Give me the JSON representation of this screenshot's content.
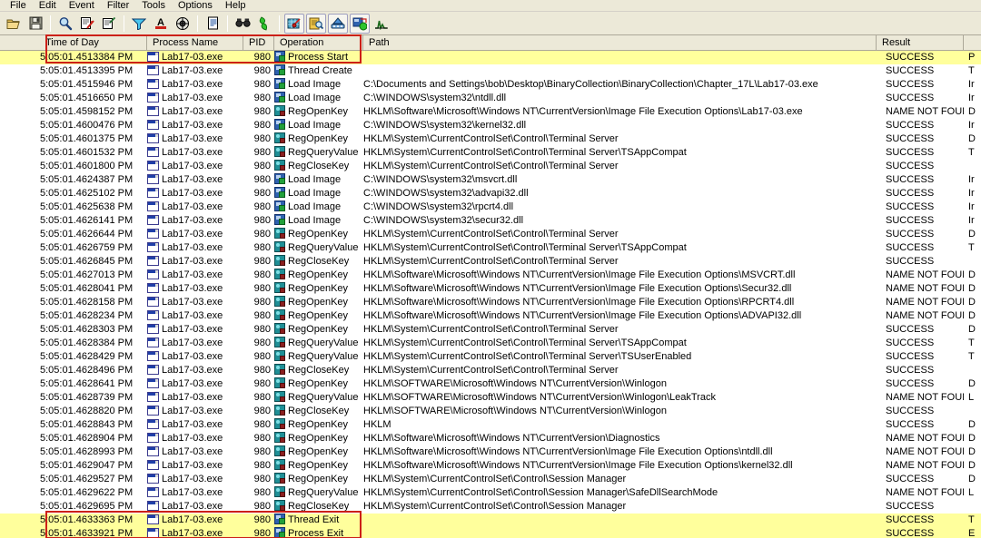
{
  "window": {
    "app_name": "Process Monitor"
  },
  "menubar": {
    "items": [
      "File",
      "Edit",
      "Event",
      "Filter",
      "Tools",
      "Options",
      "Help"
    ]
  },
  "toolbar": {
    "buttons": [
      {
        "name": "open-icon",
        "tip": "Open"
      },
      {
        "name": "save-icon",
        "tip": "Save"
      },
      {
        "name": "capture-events-icon",
        "tip": "Capture Events"
      },
      {
        "name": "autoscroll-icon",
        "tip": "Autoscroll"
      },
      {
        "name": "clear-display-icon",
        "tip": "Clear Display"
      },
      {
        "name": "filter-icon",
        "tip": "Filter"
      },
      {
        "name": "highlight-icon",
        "tip": "Highlight"
      },
      {
        "name": "include-process-icon",
        "tip": "Process Tree"
      },
      {
        "name": "jump-to-icon",
        "tip": "Jump To Object"
      },
      {
        "name": "find-icon",
        "tip": "Find"
      },
      {
        "name": "jump-icon",
        "tip": "Jump"
      },
      {
        "name": "registry-activity-icon",
        "tip": "Show Registry Activity"
      },
      {
        "name": "file-activity-icon",
        "tip": "Show File System Activity"
      },
      {
        "name": "network-activity-icon",
        "tip": "Show Network Activity"
      },
      {
        "name": "process-activity-icon",
        "tip": "Show Process and Thread Activity"
      },
      {
        "name": "profiling-events-icon",
        "tip": "Show Profiling Events"
      }
    ]
  },
  "columns": [
    {
      "key": "time",
      "label": "Time of Day"
    },
    {
      "key": "proc",
      "label": "Process Name"
    },
    {
      "key": "pid",
      "label": "PID"
    },
    {
      "key": "op",
      "label": "Operation"
    },
    {
      "key": "path",
      "label": "Path"
    },
    {
      "key": "result",
      "label": "Result"
    },
    {
      "key": "detail",
      "label": ""
    }
  ],
  "colors": {
    "highlight_row": "#ffff9c",
    "annotation_box": "#cc2018",
    "chrome": "#ece9d8",
    "grid_line": "#aca899"
  },
  "annotations": [
    {
      "name": "process-start-callout",
      "target_rows": [
        0
      ]
    },
    {
      "name": "process-exit-callout",
      "target_rows": [
        35,
        36
      ]
    }
  ],
  "rows": [
    {
      "time": "5:05:01.4513384 PM",
      "proc": "Lab17-03.exe",
      "pid": "980",
      "op": "Process Start",
      "icon": "proc",
      "path": "",
      "result": "SUCCESS",
      "detail": "P",
      "hl": true
    },
    {
      "time": "5:05:01.4513395 PM",
      "proc": "Lab17-03.exe",
      "pid": "980",
      "op": "Thread Create",
      "icon": "proc",
      "path": "",
      "result": "SUCCESS",
      "detail": "T",
      "hl": false
    },
    {
      "time": "5:05:01.4515946 PM",
      "proc": "Lab17-03.exe",
      "pid": "980",
      "op": "Load Image",
      "icon": "proc",
      "path": "C:\\Documents and Settings\\bob\\Desktop\\BinaryCollection\\BinaryCollection\\Chapter_17L\\Lab17-03.exe",
      "result": "SUCCESS",
      "detail": "Ir",
      "hl": false
    },
    {
      "time": "5:05:01.4516650 PM",
      "proc": "Lab17-03.exe",
      "pid": "980",
      "op": "Load Image",
      "icon": "proc",
      "path": "C:\\WINDOWS\\system32\\ntdll.dll",
      "result": "SUCCESS",
      "detail": "Ir",
      "hl": false
    },
    {
      "time": "5:05:01.4598152 PM",
      "proc": "Lab17-03.exe",
      "pid": "980",
      "op": "RegOpenKey",
      "icon": "reg",
      "path": "HKLM\\Software\\Microsoft\\Windows NT\\CurrentVersion\\Image File Execution Options\\Lab17-03.exe",
      "result": "NAME NOT FOUND",
      "detail": "D",
      "hl": false
    },
    {
      "time": "5:05:01.4600476 PM",
      "proc": "Lab17-03.exe",
      "pid": "980",
      "op": "Load Image",
      "icon": "proc",
      "path": "C:\\WINDOWS\\system32\\kernel32.dll",
      "result": "SUCCESS",
      "detail": "Ir",
      "hl": false
    },
    {
      "time": "5:05:01.4601375 PM",
      "proc": "Lab17-03.exe",
      "pid": "980",
      "op": "RegOpenKey",
      "icon": "reg",
      "path": "HKLM\\System\\CurrentControlSet\\Control\\Terminal Server",
      "result": "SUCCESS",
      "detail": "D",
      "hl": false
    },
    {
      "time": "5:05:01.4601532 PM",
      "proc": "Lab17-03.exe",
      "pid": "980",
      "op": "RegQueryValue",
      "icon": "reg",
      "path": "HKLM\\System\\CurrentControlSet\\Control\\Terminal Server\\TSAppCompat",
      "result": "SUCCESS",
      "detail": "T",
      "hl": false
    },
    {
      "time": "5:05:01.4601800 PM",
      "proc": "Lab17-03.exe",
      "pid": "980",
      "op": "RegCloseKey",
      "icon": "reg",
      "path": "HKLM\\System\\CurrentControlSet\\Control\\Terminal Server",
      "result": "SUCCESS",
      "detail": "",
      "hl": false
    },
    {
      "time": "5:05:01.4624387 PM",
      "proc": "Lab17-03.exe",
      "pid": "980",
      "op": "Load Image",
      "icon": "proc",
      "path": "C:\\WINDOWS\\system32\\msvcrt.dll",
      "result": "SUCCESS",
      "detail": "Ir",
      "hl": false
    },
    {
      "time": "5:05:01.4625102 PM",
      "proc": "Lab17-03.exe",
      "pid": "980",
      "op": "Load Image",
      "icon": "proc",
      "path": "C:\\WINDOWS\\system32\\advapi32.dll",
      "result": "SUCCESS",
      "detail": "Ir",
      "hl": false
    },
    {
      "time": "5:05:01.4625638 PM",
      "proc": "Lab17-03.exe",
      "pid": "980",
      "op": "Load Image",
      "icon": "proc",
      "path": "C:\\WINDOWS\\system32\\rpcrt4.dll",
      "result": "SUCCESS",
      "detail": "Ir",
      "hl": false
    },
    {
      "time": "5:05:01.4626141 PM",
      "proc": "Lab17-03.exe",
      "pid": "980",
      "op": "Load Image",
      "icon": "proc",
      "path": "C:\\WINDOWS\\system32\\secur32.dll",
      "result": "SUCCESS",
      "detail": "Ir",
      "hl": false
    },
    {
      "time": "5:05:01.4626644 PM",
      "proc": "Lab17-03.exe",
      "pid": "980",
      "op": "RegOpenKey",
      "icon": "reg",
      "path": "HKLM\\System\\CurrentControlSet\\Control\\Terminal Server",
      "result": "SUCCESS",
      "detail": "D",
      "hl": false
    },
    {
      "time": "5:05:01.4626759 PM",
      "proc": "Lab17-03.exe",
      "pid": "980",
      "op": "RegQueryValue",
      "icon": "reg",
      "path": "HKLM\\System\\CurrentControlSet\\Control\\Terminal Server\\TSAppCompat",
      "result": "SUCCESS",
      "detail": "T",
      "hl": false
    },
    {
      "time": "5:05:01.4626845 PM",
      "proc": "Lab17-03.exe",
      "pid": "980",
      "op": "RegCloseKey",
      "icon": "reg",
      "path": "HKLM\\System\\CurrentControlSet\\Control\\Terminal Server",
      "result": "SUCCESS",
      "detail": "",
      "hl": false
    },
    {
      "time": "5:05:01.4627013 PM",
      "proc": "Lab17-03.exe",
      "pid": "980",
      "op": "RegOpenKey",
      "icon": "reg",
      "path": "HKLM\\Software\\Microsoft\\Windows NT\\CurrentVersion\\Image File Execution Options\\MSVCRT.dll",
      "result": "NAME NOT FOUND",
      "detail": "D",
      "hl": false
    },
    {
      "time": "5:05:01.4628041 PM",
      "proc": "Lab17-03.exe",
      "pid": "980",
      "op": "RegOpenKey",
      "icon": "reg",
      "path": "HKLM\\Software\\Microsoft\\Windows NT\\CurrentVersion\\Image File Execution Options\\Secur32.dll",
      "result": "NAME NOT FOUND",
      "detail": "D",
      "hl": false
    },
    {
      "time": "5:05:01.4628158 PM",
      "proc": "Lab17-03.exe",
      "pid": "980",
      "op": "RegOpenKey",
      "icon": "reg",
      "path": "HKLM\\Software\\Microsoft\\Windows NT\\CurrentVersion\\Image File Execution Options\\RPCRT4.dll",
      "result": "NAME NOT FOUND",
      "detail": "D",
      "hl": false
    },
    {
      "time": "5:05:01.4628234 PM",
      "proc": "Lab17-03.exe",
      "pid": "980",
      "op": "RegOpenKey",
      "icon": "reg",
      "path": "HKLM\\Software\\Microsoft\\Windows NT\\CurrentVersion\\Image File Execution Options\\ADVAPI32.dll",
      "result": "NAME NOT FOUND",
      "detail": "D",
      "hl": false
    },
    {
      "time": "5:05:01.4628303 PM",
      "proc": "Lab17-03.exe",
      "pid": "980",
      "op": "RegOpenKey",
      "icon": "reg",
      "path": "HKLM\\System\\CurrentControlSet\\Control\\Terminal Server",
      "result": "SUCCESS",
      "detail": "D",
      "hl": false
    },
    {
      "time": "5:05:01.4628384 PM",
      "proc": "Lab17-03.exe",
      "pid": "980",
      "op": "RegQueryValue",
      "icon": "reg",
      "path": "HKLM\\System\\CurrentControlSet\\Control\\Terminal Server\\TSAppCompat",
      "result": "SUCCESS",
      "detail": "T",
      "hl": false
    },
    {
      "time": "5:05:01.4628429 PM",
      "proc": "Lab17-03.exe",
      "pid": "980",
      "op": "RegQueryValue",
      "icon": "reg",
      "path": "HKLM\\System\\CurrentControlSet\\Control\\Terminal Server\\TSUserEnabled",
      "result": "SUCCESS",
      "detail": "T",
      "hl": false
    },
    {
      "time": "5:05:01.4628496 PM",
      "proc": "Lab17-03.exe",
      "pid": "980",
      "op": "RegCloseKey",
      "icon": "reg",
      "path": "HKLM\\System\\CurrentControlSet\\Control\\Terminal Server",
      "result": "SUCCESS",
      "detail": "",
      "hl": false
    },
    {
      "time": "5:05:01.4628641 PM",
      "proc": "Lab17-03.exe",
      "pid": "980",
      "op": "RegOpenKey",
      "icon": "reg",
      "path": "HKLM\\SOFTWARE\\Microsoft\\Windows NT\\CurrentVersion\\Winlogon",
      "result": "SUCCESS",
      "detail": "D",
      "hl": false
    },
    {
      "time": "5:05:01.4628739 PM",
      "proc": "Lab17-03.exe",
      "pid": "980",
      "op": "RegQueryValue",
      "icon": "reg",
      "path": "HKLM\\SOFTWARE\\Microsoft\\Windows NT\\CurrentVersion\\Winlogon\\LeakTrack",
      "result": "NAME NOT FOUND",
      "detail": "L",
      "hl": false
    },
    {
      "time": "5:05:01.4628820 PM",
      "proc": "Lab17-03.exe",
      "pid": "980",
      "op": "RegCloseKey",
      "icon": "reg",
      "path": "HKLM\\SOFTWARE\\Microsoft\\Windows NT\\CurrentVersion\\Winlogon",
      "result": "SUCCESS",
      "detail": "",
      "hl": false
    },
    {
      "time": "5:05:01.4628843 PM",
      "proc": "Lab17-03.exe",
      "pid": "980",
      "op": "RegOpenKey",
      "icon": "reg",
      "path": "HKLM",
      "result": "SUCCESS",
      "detail": "D",
      "hl": false
    },
    {
      "time": "5:05:01.4628904 PM",
      "proc": "Lab17-03.exe",
      "pid": "980",
      "op": "RegOpenKey",
      "icon": "reg",
      "path": "HKLM\\Software\\Microsoft\\Windows NT\\CurrentVersion\\Diagnostics",
      "result": "NAME NOT FOUND",
      "detail": "D",
      "hl": false
    },
    {
      "time": "5:05:01.4628993 PM",
      "proc": "Lab17-03.exe",
      "pid": "980",
      "op": "RegOpenKey",
      "icon": "reg",
      "path": "HKLM\\Software\\Microsoft\\Windows NT\\CurrentVersion\\Image File Execution Options\\ntdll.dll",
      "result": "NAME NOT FOUND",
      "detail": "D",
      "hl": false
    },
    {
      "time": "5:05:01.4629047 PM",
      "proc": "Lab17-03.exe",
      "pid": "980",
      "op": "RegOpenKey",
      "icon": "reg",
      "path": "HKLM\\Software\\Microsoft\\Windows NT\\CurrentVersion\\Image File Execution Options\\kernel32.dll",
      "result": "NAME NOT FOUND",
      "detail": "D",
      "hl": false
    },
    {
      "time": "5:05:01.4629527 PM",
      "proc": "Lab17-03.exe",
      "pid": "980",
      "op": "RegOpenKey",
      "icon": "reg",
      "path": "HKLM\\System\\CurrentControlSet\\Control\\Session Manager",
      "result": "SUCCESS",
      "detail": "D",
      "hl": false
    },
    {
      "time": "5:05:01.4629622 PM",
      "proc": "Lab17-03.exe",
      "pid": "980",
      "op": "RegQueryValue",
      "icon": "reg",
      "path": "HKLM\\System\\CurrentControlSet\\Control\\Session Manager\\SafeDllSearchMode",
      "result": "NAME NOT FOUND",
      "detail": "L",
      "hl": false
    },
    {
      "time": "5:05:01.4629695 PM",
      "proc": "Lab17-03.exe",
      "pid": "980",
      "op": "RegCloseKey",
      "icon": "reg",
      "path": "HKLM\\System\\CurrentControlSet\\Control\\Session Manager",
      "result": "SUCCESS",
      "detail": "",
      "hl": false
    },
    {
      "time": "5:05:01.4633363 PM",
      "proc": "Lab17-03.exe",
      "pid": "980",
      "op": "Thread Exit",
      "icon": "proc",
      "path": "",
      "result": "SUCCESS",
      "detail": "T",
      "hl": true
    },
    {
      "time": "5:05:01.4633921 PM",
      "proc": "Lab17-03.exe",
      "pid": "980",
      "op": "Process Exit",
      "icon": "proc",
      "path": "",
      "result": "SUCCESS",
      "detail": "E",
      "hl": true
    }
  ]
}
